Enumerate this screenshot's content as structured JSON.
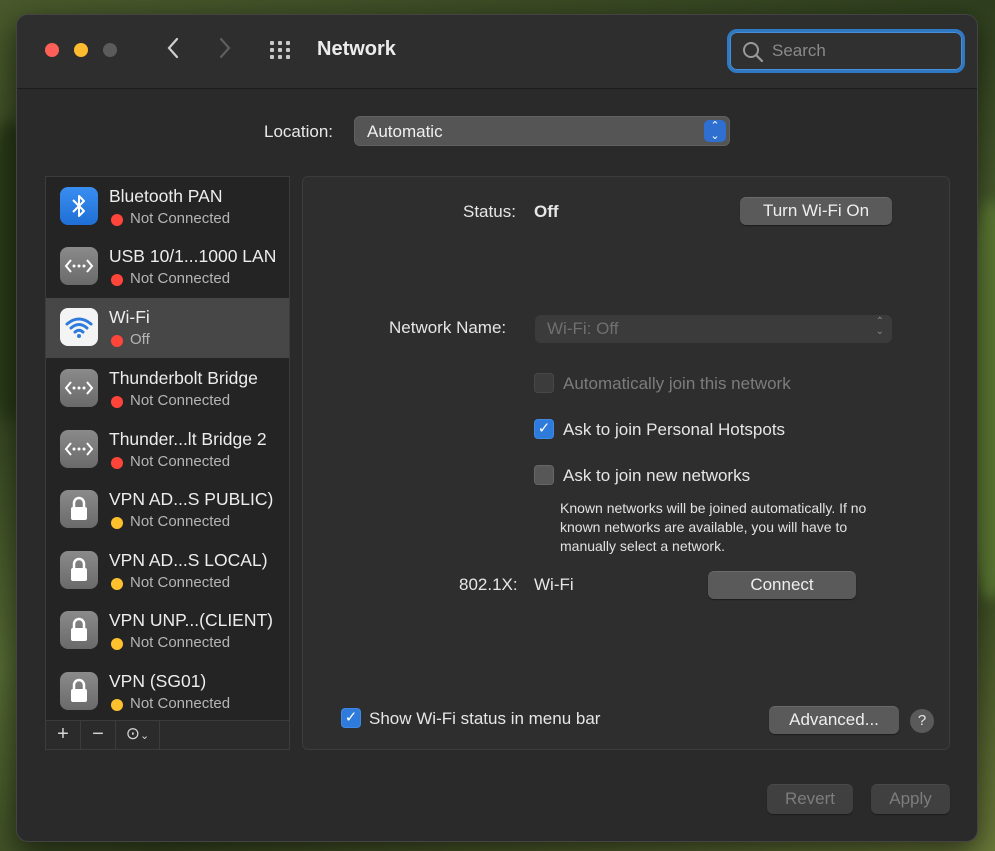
{
  "window": {
    "title": "Network",
    "search_placeholder": "Search",
    "back_icon": "chevron-left-icon",
    "forward_icon": "chevron-right-icon",
    "grid_icon": "show-all-grid-icon"
  },
  "location": {
    "label": "Location:",
    "value": "Automatic"
  },
  "services": [
    {
      "name": "Bluetooth PAN",
      "status": "Not Connected",
      "status_color": "#ff453a",
      "icon": "bluetooth-icon"
    },
    {
      "name": "USB 10/1...1000 LAN",
      "status": "Not Connected",
      "status_color": "#ff453a",
      "icon": "ethernet-icon"
    },
    {
      "name": "Wi-Fi",
      "status": "Off",
      "status_color": "#ff453a",
      "icon": "wifi-icon",
      "selected": true
    },
    {
      "name": "Thunderbolt Bridge",
      "status": "Not Connected",
      "status_color": "#ff453a",
      "icon": "ethernet-icon"
    },
    {
      "name": "Thunder...lt Bridge 2",
      "status": "Not Connected",
      "status_color": "#ff453a",
      "icon": "ethernet-icon"
    },
    {
      "name": "VPN AD...S PUBLIC)",
      "status": "Not Connected",
      "status_color": "#ffc02e",
      "icon": "lock-icon"
    },
    {
      "name": "VPN AD...S LOCAL)",
      "status": "Not Connected",
      "status_color": "#ffc02e",
      "icon": "lock-icon"
    },
    {
      "name": "VPN UNP...(CLIENT)",
      "status": "Not Connected",
      "status_color": "#ffc02e",
      "icon": "lock-icon"
    },
    {
      "name": "VPN (SG01)",
      "status": "Not Connected",
      "status_color": "#ffc02e",
      "icon": "lock-icon"
    }
  ],
  "sidebar_toolbar": {
    "add": "+",
    "remove": "−",
    "action": "⊙"
  },
  "detail": {
    "status_label": "Status:",
    "status_value": "Off",
    "turn_on_button": "Turn Wi-Fi On",
    "network_name_label": "Network Name:",
    "network_name_value": "Wi-Fi: Off",
    "auto_join_label": "Automatically join this network",
    "auto_join_checked": false,
    "ask_hotspots_label": "Ask to join Personal Hotspots",
    "ask_hotspots_checked": true,
    "ask_new_label": "Ask to join new networks",
    "ask_new_checked": false,
    "help_note": "Known networks will be joined automatically. If no known networks are available, you will have to manually select a network.",
    "dot1x_label": "802.1X:",
    "dot1x_value": "Wi-Fi",
    "connect_button": "Connect",
    "show_status_label": "Show Wi-Fi status in menu bar",
    "show_status_checked": true,
    "advanced_button": "Advanced...",
    "help_button": "?"
  },
  "footer": {
    "revert_button": "Revert",
    "apply_button": "Apply"
  },
  "colors": {
    "accent": "#2f7bdc",
    "focus_ring": "#2f78c4",
    "status_red": "#ff453a",
    "status_yellow": "#ffc02e"
  }
}
